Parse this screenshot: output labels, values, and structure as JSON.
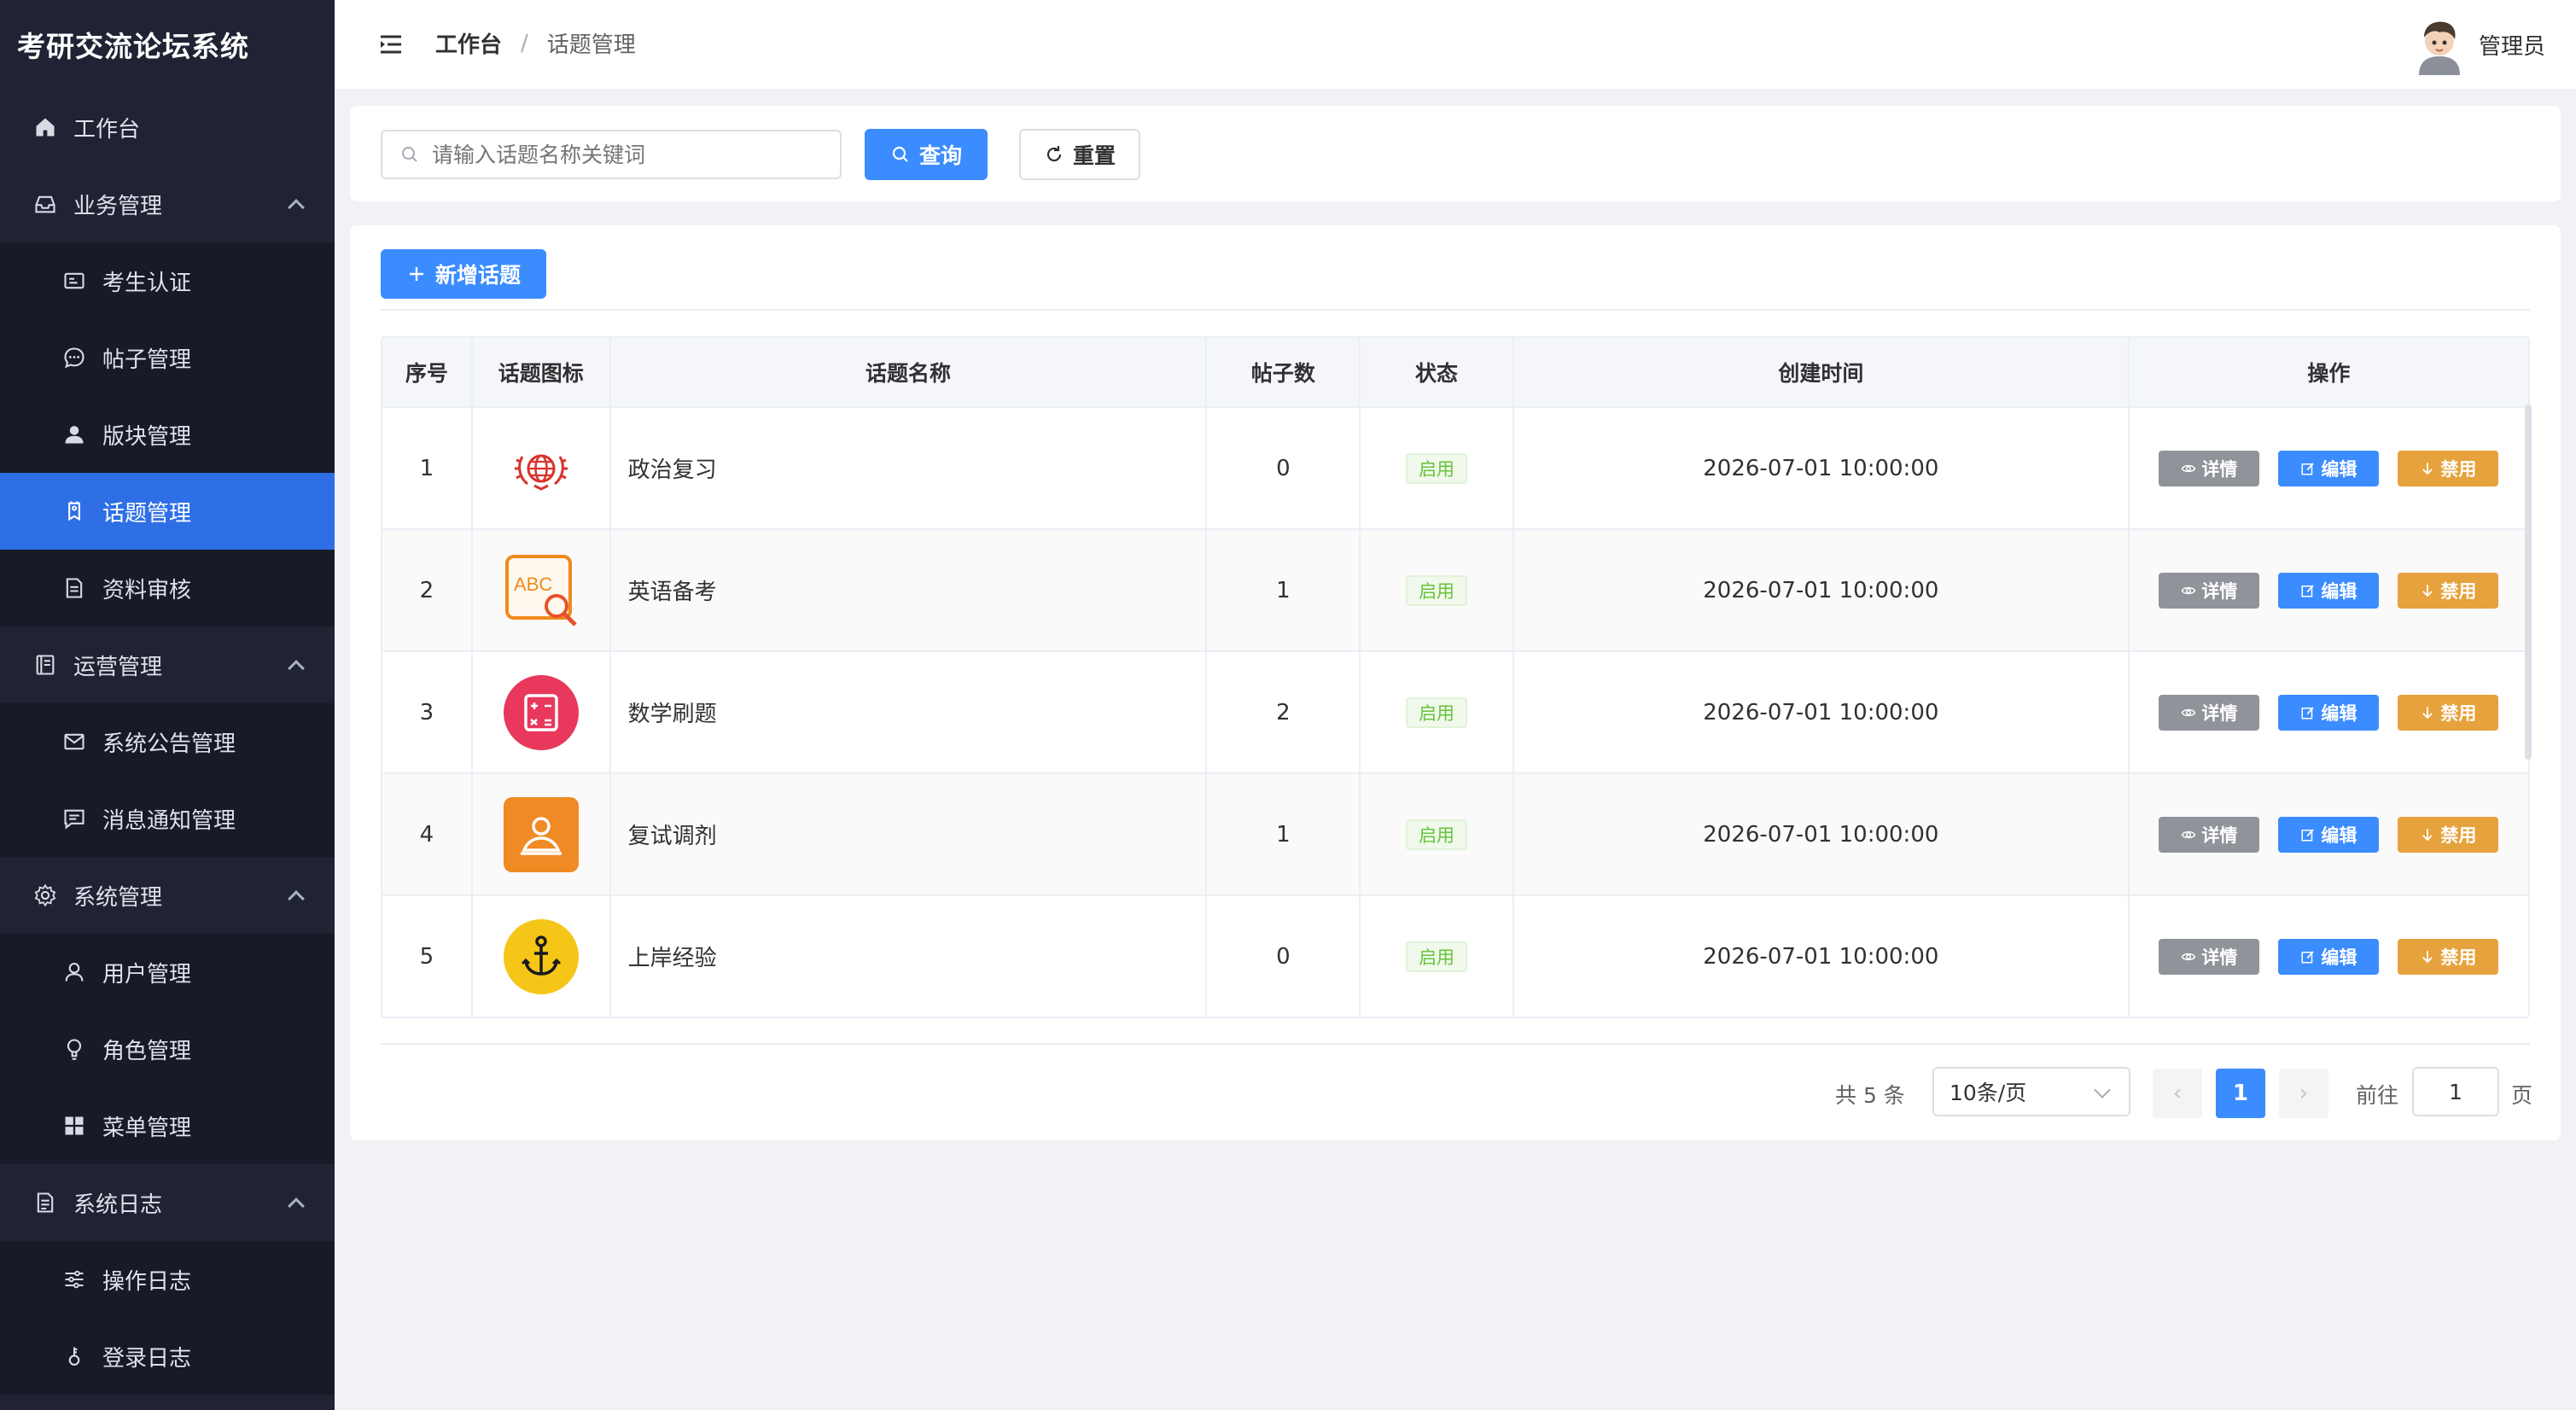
{
  "app": {
    "title": "考研交流论坛系统"
  },
  "sidebar": {
    "items": [
      {
        "label": "工作台",
        "icon": "home-icon",
        "level": "top"
      },
      {
        "label": "业务管理",
        "icon": "inbox-icon",
        "level": "group"
      },
      {
        "label": "考生认证",
        "icon": "id-card-icon",
        "level": "sub"
      },
      {
        "label": "帖子管理",
        "icon": "chat-icon",
        "level": "sub"
      },
      {
        "label": "版块管理",
        "icon": "user-icon",
        "level": "sub"
      },
      {
        "label": "话题管理",
        "icon": "tag-icon",
        "level": "sub",
        "active": true
      },
      {
        "label": "资料审核",
        "icon": "document-icon",
        "level": "sub"
      },
      {
        "label": "运营管理",
        "icon": "notebook-icon",
        "level": "group"
      },
      {
        "label": "系统公告管理",
        "icon": "message-icon",
        "level": "sub"
      },
      {
        "label": "消息通知管理",
        "icon": "chat-square-icon",
        "level": "sub"
      },
      {
        "label": "系统管理",
        "icon": "gear-icon",
        "level": "group"
      },
      {
        "label": "用户管理",
        "icon": "user-outline-icon",
        "level": "sub"
      },
      {
        "label": "角色管理",
        "icon": "bulb-icon",
        "level": "sub"
      },
      {
        "label": "菜单管理",
        "icon": "grid-icon",
        "level": "sub"
      },
      {
        "label": "系统日志",
        "icon": "log-icon",
        "level": "group"
      },
      {
        "label": "操作日志",
        "icon": "operation-icon",
        "level": "sub"
      },
      {
        "label": "登录日志",
        "icon": "key-icon",
        "level": "sub"
      }
    ]
  },
  "header": {
    "breadcrumb_home": "工作台",
    "breadcrumb_separator": "/",
    "breadcrumb_current": "话题管理",
    "user_name": "管理员"
  },
  "search": {
    "placeholder": "请输入话题名称关键词",
    "value": "",
    "query_label": "查询",
    "reset_label": "重置"
  },
  "toolbar": {
    "add_label": "新增话题"
  },
  "table": {
    "columns": [
      "序号",
      "话题图标",
      "话题名称",
      "帖子数",
      "状态",
      "创建时间",
      "操作"
    ],
    "rows": [
      {
        "index": "1",
        "icon": "globe-laurel-icon",
        "name": "政治复习",
        "posts": "0",
        "status": "启用",
        "created": "2026-07-01 10:00:00"
      },
      {
        "index": "2",
        "icon": "abc-search-icon",
        "name": "英语备考",
        "posts": "1",
        "status": "启用",
        "created": "2026-07-01 10:00:00"
      },
      {
        "index": "3",
        "icon": "calculator-icon",
        "name": "数学刷题",
        "posts": "2",
        "status": "启用",
        "created": "2026-07-01 10:00:00"
      },
      {
        "index": "4",
        "icon": "person-card-icon",
        "name": "复试调剂",
        "posts": "1",
        "status": "启用",
        "created": "2026-07-01 10:00:00"
      },
      {
        "index": "5",
        "icon": "anchor-icon",
        "name": "上岸经验",
        "posts": "0",
        "status": "启用",
        "created": "2026-07-01 10:00:00"
      }
    ],
    "actions": {
      "detail": "详情",
      "edit": "编辑",
      "disable": "禁用"
    }
  },
  "pagination": {
    "total_text": "共 5 条",
    "page_size": "10条/页",
    "current_page": "1",
    "goto_label": "前往",
    "goto_value": "1",
    "page_suffix": "页"
  },
  "colors": {
    "primary": "#3b8cff",
    "sidebar_bg": "#1f2333",
    "active_menu": "#2f6fe6",
    "warning": "#e6a23c",
    "info": "#909399",
    "success": "#67c23a"
  }
}
